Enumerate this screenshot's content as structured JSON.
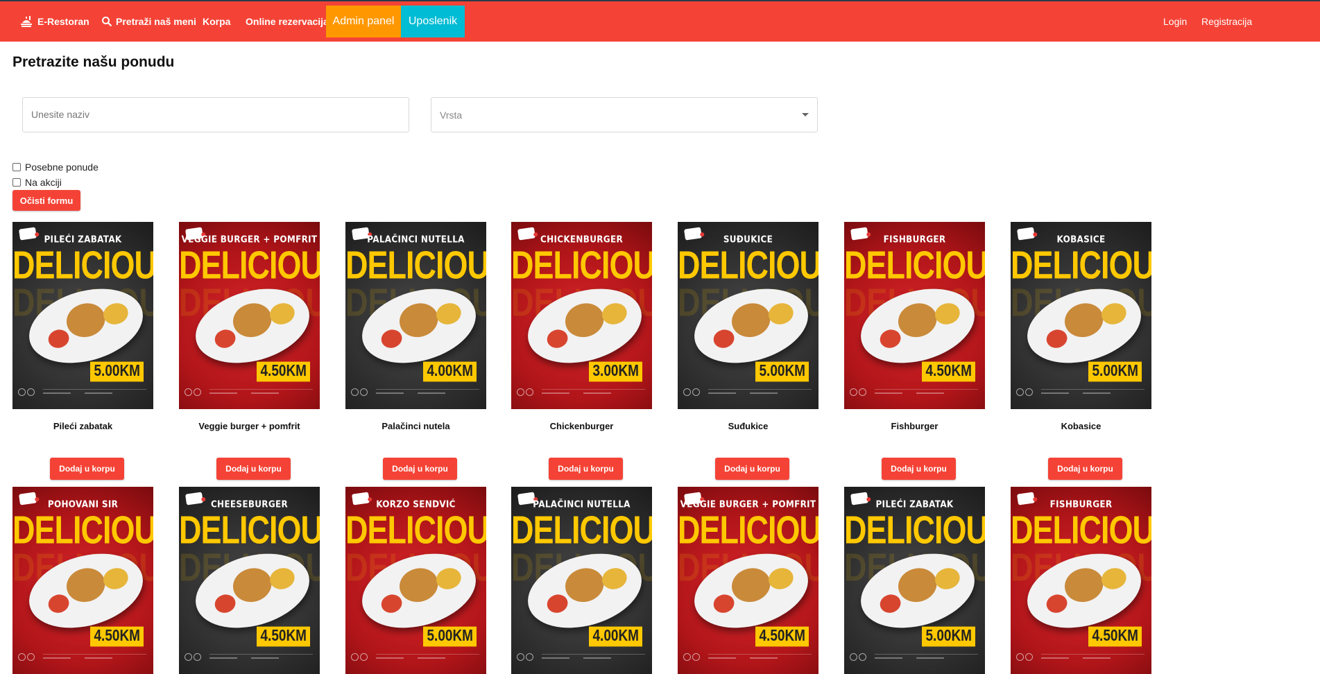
{
  "nav": {
    "brand": "E-Restoran",
    "search": "Pretraži naš meni",
    "korpa": "Korpa",
    "rezervacija": "Online rezervacija",
    "admin": "Admin panel",
    "uposlenik": "Uposlenik",
    "login": "Login",
    "registracija": "Registracija"
  },
  "page": {
    "title": "Pretrazite našu ponudu"
  },
  "filters": {
    "name_placeholder": "Unesite naziv",
    "vrsta_placeholder": "Vrsta",
    "posebne_label": "Posebne ponude",
    "akcija_label": "Na akciji",
    "clear_label": "Očisti formu"
  },
  "colors": {
    "primary": "#f44336",
    "admin": "#ff9800",
    "uposlenik": "#00bcd4",
    "poster_yellow": "#ffc800"
  },
  "add_label": "Dodaj u korpu",
  "poster_slogan": "DELICIOUS",
  "products": [
    {
      "name": "Pileći zabatak",
      "poster_title": "PILEĆI ZABATAK",
      "price": "5.00KM",
      "bg": "dark"
    },
    {
      "name": "Veggie burger + pomfrit",
      "poster_title": "VEGGIE BURGER + POMFRIT",
      "price": "4.50KM",
      "bg": "red"
    },
    {
      "name": "Palačinci nutela",
      "poster_title": "PALAČINCI NUTELLA",
      "price": "4.00KM",
      "bg": "dark"
    },
    {
      "name": "Chickenburger",
      "poster_title": "CHICKENBURGER",
      "price": "3.00KM",
      "bg": "red"
    },
    {
      "name": "Suđukice",
      "poster_title": "SUĐUKICE",
      "price": "5.00KM",
      "bg": "dark"
    },
    {
      "name": "Fishburger",
      "poster_title": "FISHBURGER",
      "price": "4.50KM",
      "bg": "red"
    },
    {
      "name": "Kobasice",
      "poster_title": "KOBASICE",
      "price": "5.00KM",
      "bg": "dark"
    },
    {
      "name": "",
      "poster_title": "POHOVANI SIR",
      "price": "4.50KM",
      "bg": "red"
    },
    {
      "name": "",
      "poster_title": "CHEESEBURGER",
      "price": "4.50KM",
      "bg": "dark"
    },
    {
      "name": "",
      "poster_title": "KORZO SENDVIĆ",
      "price": "5.00KM",
      "bg": "red"
    },
    {
      "name": "",
      "poster_title": "PALAČINCI NUTELLA",
      "price": "4.00KM",
      "bg": "dark"
    },
    {
      "name": "",
      "poster_title": "VEGGIE BURGER + POMFRIT",
      "price": "4.50KM",
      "bg": "red"
    },
    {
      "name": "",
      "poster_title": "PILEĆI ZABATAK",
      "price": "5.00KM",
      "bg": "dark"
    },
    {
      "name": "",
      "poster_title": "FISHBURGER",
      "price": "4.50KM",
      "bg": "red"
    }
  ]
}
